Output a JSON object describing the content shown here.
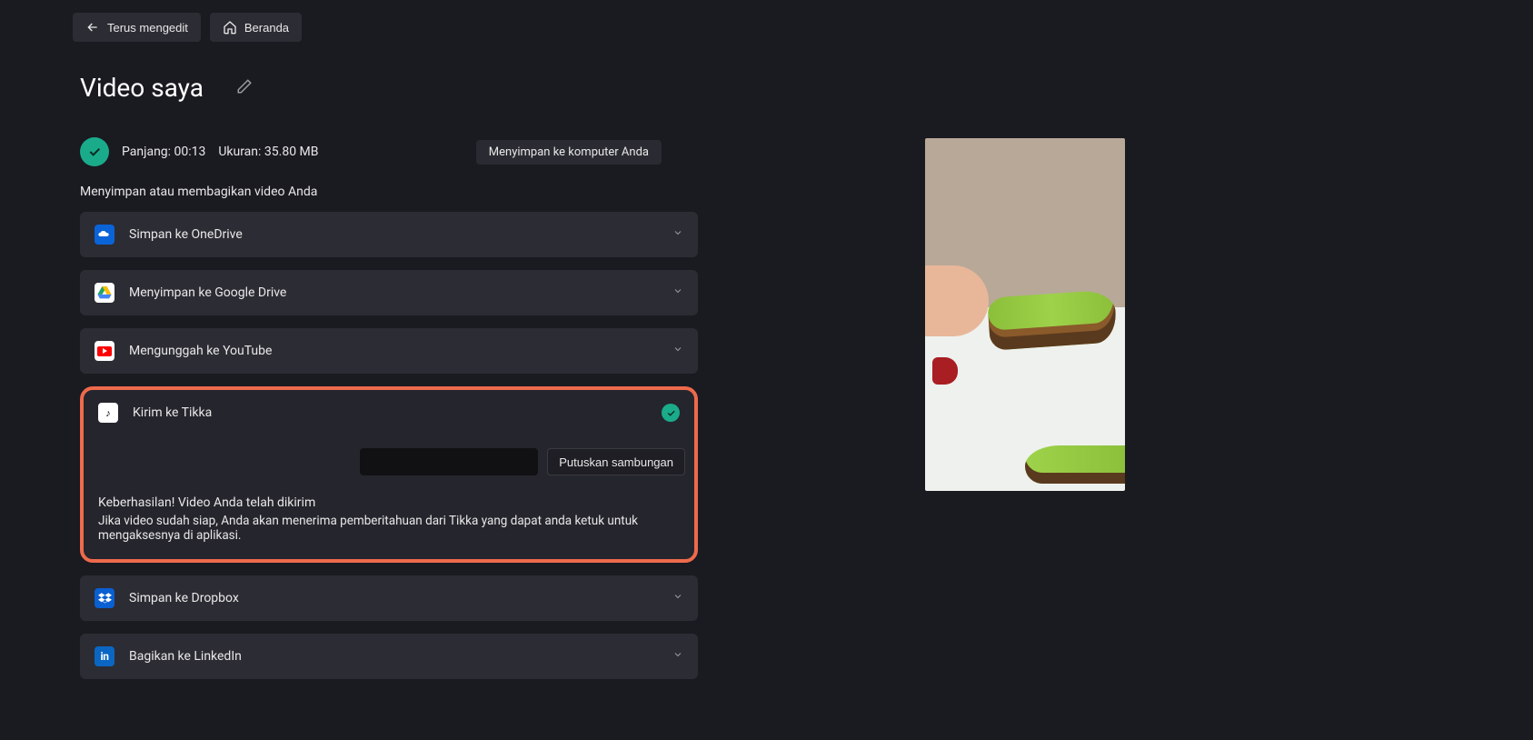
{
  "nav": {
    "continue_edit": "Terus mengedit",
    "home": "Beranda"
  },
  "title": "Video saya",
  "status": {
    "length_label": "Panjang:",
    "length_value": "00:13",
    "size_label": "Ukuran:",
    "size_value": "35.80 MB",
    "saving": "Menyimpan ke komputer Anda"
  },
  "share_heading": "Menyimpan atau membagikan video Anda",
  "share": {
    "onedrive": "Simpan ke OneDrive",
    "gdrive": "Menyimpan ke Google Drive",
    "youtube": "Mengunggah ke YouTube",
    "tiktok": "Kirim ke Tikka",
    "dropbox": "Simpan ke Dropbox",
    "linkedin": "Bagikan ke LinkedIn"
  },
  "tiktok_panel": {
    "disconnect": "Putuskan sambungan",
    "success_title": "Keberhasilan! Video Anda telah dikirim",
    "success_body": "Jika video sudah siap, Anda akan menerima pemberitahuan dari Tikka yang dapat anda ketuk untuk mengaksesnya di aplikasi."
  },
  "icons": {
    "linkedin_text": "in",
    "tiktok_char": "♪"
  },
  "colors": {
    "highlight_border": "#ee6a4c",
    "accent_green": "#1aab8a",
    "bg": "#1a1a21",
    "card": "#2c2c34"
  }
}
